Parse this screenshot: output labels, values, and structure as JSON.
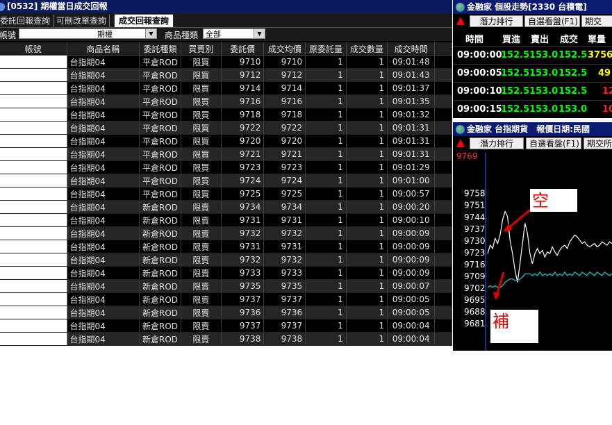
{
  "left_window": {
    "title": "[0532] 期權當日成交回報",
    "tabs": [
      "委託回報查詢",
      "可刪改單查詢",
      "成交回報查詢"
    ],
    "active_tab": 2,
    "filter": {
      "account_label": "帳號",
      "type_select_value": "期權",
      "category_label": "商品種類",
      "category_select_value": "全部"
    },
    "columns": [
      "帳號",
      "商品名稱",
      "委託種類",
      "買賣別",
      "委託價",
      "成交均價",
      "原委託量",
      "成交數量",
      "成交時間"
    ],
    "rows": [
      {
        "product": "台指期04",
        "order_type": "平倉ROD",
        "side": "限買",
        "price": "9710",
        "avg": "9710",
        "orig_qty": "1",
        "fill_qty": "1",
        "time": "09:01:48"
      },
      {
        "product": "台指期04",
        "order_type": "平倉ROD",
        "side": "限買",
        "price": "9712",
        "avg": "9712",
        "orig_qty": "1",
        "fill_qty": "1",
        "time": "09:01:43"
      },
      {
        "product": "台指期04",
        "order_type": "平倉ROD",
        "side": "限買",
        "price": "9714",
        "avg": "9714",
        "orig_qty": "1",
        "fill_qty": "1",
        "time": "09:01:37"
      },
      {
        "product": "台指期04",
        "order_type": "平倉ROD",
        "side": "限買",
        "price": "9716",
        "avg": "9716",
        "orig_qty": "1",
        "fill_qty": "1",
        "time": "09:01:35"
      },
      {
        "product": "台指期04",
        "order_type": "平倉ROD",
        "side": "限買",
        "price": "9718",
        "avg": "9718",
        "orig_qty": "1",
        "fill_qty": "1",
        "time": "09:01:32"
      },
      {
        "product": "台指期04",
        "order_type": "平倉ROD",
        "side": "限買",
        "price": "9722",
        "avg": "9722",
        "orig_qty": "1",
        "fill_qty": "1",
        "time": "09:01:31"
      },
      {
        "product": "台指期04",
        "order_type": "平倉ROD",
        "side": "限買",
        "price": "9720",
        "avg": "9720",
        "orig_qty": "1",
        "fill_qty": "1",
        "time": "09:01:31"
      },
      {
        "product": "台指期04",
        "order_type": "平倉ROD",
        "side": "限買",
        "price": "9721",
        "avg": "9721",
        "orig_qty": "1",
        "fill_qty": "1",
        "time": "09:01:31"
      },
      {
        "product": "台指期04",
        "order_type": "平倉ROD",
        "side": "限買",
        "price": "9723",
        "avg": "9723",
        "orig_qty": "1",
        "fill_qty": "1",
        "time": "09:01:29"
      },
      {
        "product": "台指期04",
        "order_type": "平倉ROD",
        "side": "限買",
        "price": "9724",
        "avg": "9724",
        "orig_qty": "1",
        "fill_qty": "1",
        "time": "09:01:00"
      },
      {
        "product": "台指期04",
        "order_type": "平倉ROD",
        "side": "限買",
        "price": "9725",
        "avg": "9725",
        "orig_qty": "1",
        "fill_qty": "1",
        "time": "09:00:57"
      },
      {
        "product": "台指期04",
        "order_type": "新倉ROD",
        "side": "限賣",
        "price": "9734",
        "avg": "9734",
        "orig_qty": "1",
        "fill_qty": "1",
        "time": "09:00:20"
      },
      {
        "product": "台指期04",
        "order_type": "新倉ROD",
        "side": "限賣",
        "price": "9731",
        "avg": "9731",
        "orig_qty": "1",
        "fill_qty": "1",
        "time": "09:00:10"
      },
      {
        "product": "台指期04",
        "order_type": "新倉ROD",
        "side": "限賣",
        "price": "9732",
        "avg": "9732",
        "orig_qty": "1",
        "fill_qty": "1",
        "time": "09:00:09"
      },
      {
        "product": "台指期04",
        "order_type": "新倉ROD",
        "side": "限賣",
        "price": "9731",
        "avg": "9731",
        "orig_qty": "1",
        "fill_qty": "1",
        "time": "09:00:09"
      },
      {
        "product": "台指期04",
        "order_type": "新倉ROD",
        "side": "限賣",
        "price": "9732",
        "avg": "9732",
        "orig_qty": "1",
        "fill_qty": "1",
        "time": "09:00:09"
      },
      {
        "product": "台指期04",
        "order_type": "新倉ROD",
        "side": "限賣",
        "price": "9733",
        "avg": "9733",
        "orig_qty": "1",
        "fill_qty": "1",
        "time": "09:00:09"
      },
      {
        "product": "台指期04",
        "order_type": "新倉ROD",
        "side": "限賣",
        "price": "9735",
        "avg": "9735",
        "orig_qty": "1",
        "fill_qty": "1",
        "time": "09:00:07"
      },
      {
        "product": "台指期04",
        "order_type": "新倉ROD",
        "side": "限賣",
        "price": "9737",
        "avg": "9737",
        "orig_qty": "1",
        "fill_qty": "1",
        "time": "09:00:05"
      },
      {
        "product": "台指期04",
        "order_type": "新倉ROD",
        "side": "限賣",
        "price": "9736",
        "avg": "9736",
        "orig_qty": "1",
        "fill_qty": "1",
        "time": "09:00:05"
      },
      {
        "product": "台指期04",
        "order_type": "新倉ROD",
        "side": "限賣",
        "price": "9737",
        "avg": "9737",
        "orig_qty": "1",
        "fill_qty": "1",
        "time": "09:00:04"
      },
      {
        "product": "台指期04",
        "order_type": "新倉ROD",
        "side": "限賣",
        "price": "9738",
        "avg": "9738",
        "orig_qty": "1",
        "fill_qty": "1",
        "time": "09:00:04"
      }
    ]
  },
  "stock_panel": {
    "title": "金融家 個股走勢[2330 台積電]",
    "buttons": [
      "潛力排行",
      "自選看盤(F1)",
      "期交"
    ],
    "headers": [
      "時間",
      "買進",
      "賣出",
      "成交",
      "單量"
    ],
    "ticks": [
      {
        "time": "09:00:00",
        "bid": "152.5",
        "ask": "153.0",
        "last": "152.5",
        "vol": "3756"
      },
      {
        "time": "09:00:05",
        "bid": "152.5",
        "ask": "153.0",
        "last": "152.5",
        "vol": "49"
      },
      {
        "time": "09:00:10",
        "bid": "152.5",
        "ask": "153.0",
        "last": "152.5",
        "vol": "12"
      },
      {
        "time": "09:00:15",
        "bid": "152.5",
        "ask": "153.0",
        "last": "153.0",
        "vol": "10"
      }
    ]
  },
  "futures_panel": {
    "title": "金融家 台指期貨",
    "date_label": "報價日期:民國",
    "buttons": [
      "潛力排行",
      "自選看盤(F1)",
      "期交所"
    ],
    "annotation_short": "空",
    "annotation_cover": "補",
    "colors": {
      "price_line": "#ffffff",
      "avg_line": "#2aa6a0",
      "arrow": "#e00000",
      "top_label": "#ff3030"
    }
  },
  "chart_data": {
    "type": "line",
    "y_ticks": [
      9769,
      9758,
      9751,
      9744,
      9737,
      9730,
      9723,
      9716,
      9709,
      9702,
      9695,
      9688,
      9681
    ],
    "ylim": [
      9681,
      9769
    ],
    "series": [
      {
        "values": [
          9722,
          9727,
          9725,
          9731,
          9728,
          9733,
          9742,
          9747,
          9744,
          9730,
          9722,
          9712,
          9705,
          9716,
          9728,
          9740,
          9734,
          9722,
          9716,
          9722,
          9725,
          9722,
          9724,
          9720,
          9723,
          9722,
          9726,
          9723,
          9721,
          9724,
          9726,
          9727,
          9725,
          9729,
          9731,
          9733,
          9732,
          9730,
          9728,
          9729,
          9727,
          9726,
          9727,
          9728,
          9726,
          9727,
          9729,
          9728,
          9727,
          9729,
          9728
        ]
      },
      {
        "values": [
          9702,
          9703,
          9702,
          9703,
          9702,
          9702,
          9703,
          9705,
          9706,
          9707,
          9707,
          9706,
          9706,
          9707,
          9708,
          9710,
          9710,
          9710,
          9709,
          9710,
          9709,
          9711,
          9709,
          9710,
          9709,
          9710,
          9709,
          9711,
          9709,
          9710,
          9709,
          9711,
          9709,
          9710,
          9709,
          9711,
          9710,
          9709,
          9711,
          9710,
          9709,
          9711,
          9710,
          9709,
          9711,
          9710,
          9709,
          9711,
          9710,
          9709,
          9710
        ]
      }
    ]
  }
}
